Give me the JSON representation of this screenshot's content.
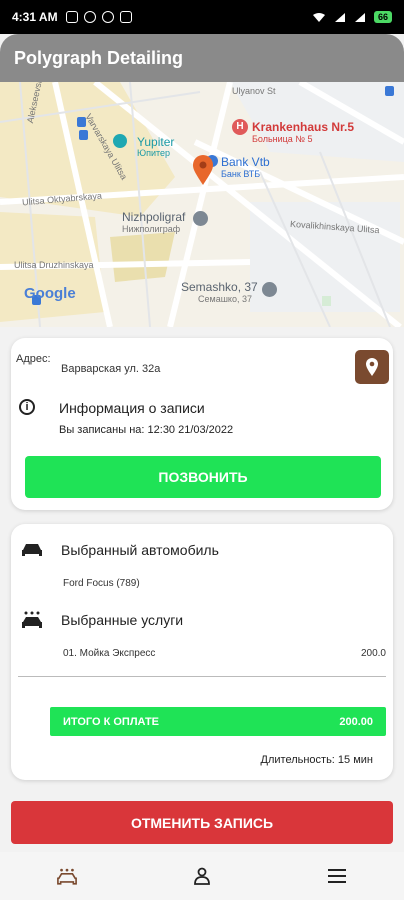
{
  "status_bar": {
    "time": "4:31 AM",
    "battery": "66"
  },
  "app": {
    "title": "Polygraph Detailing"
  },
  "map": {
    "labels": {
      "yupiter": "Yupiter",
      "yupiter_ru": "Юпитер",
      "krankenhaus": "Krankenhaus Nr.5",
      "krankenhaus_ru": "Больница № 5",
      "bank": "Bank Vtb",
      "bank_ru": "Банк ВТБ",
      "nizhpoligraf": "Nizhpoligraf",
      "nizhpoligraf_ru": "Нижполиграф",
      "semashko": "Semashko, 37",
      "semashko_ru": "Семашко, 37",
      "ulitsa_oktyabrskaya": "Ulitsa Oktyabrskaya",
      "ulitsa_druzhinskaya": "Ulitsa Druzhinskaya",
      "alekseevskaya": "Alekseevskaya Ulitsa",
      "varvarskaya": "Varvarskaya Ulitsa",
      "kovalikhinskaya": "Kovalikhinskaya Ulitsa",
      "ulyanov": "Ulyanov St",
      "google": "Google"
    }
  },
  "booking": {
    "address_label": "Адрес:",
    "address_value": "Варварская ул. 32а",
    "info_title": "Информация о записи",
    "info_sub": "Вы записаны на: 12:30 21/03/2022",
    "call_button": "ПОЗВОНИТЬ"
  },
  "details": {
    "car_title": "Выбранный автомобиль",
    "car_value": "Ford Focus (789)",
    "services_title": "Выбранные услуги",
    "services": [
      {
        "name": "01. Мойка Экспресс",
        "price": "200.0"
      }
    ],
    "total_label": "ИТОГО К ОПЛАТЕ",
    "total_value": "200.00",
    "duration": "Длительность: 15 мин"
  },
  "cancel_button": "ОТМЕНИТЬ ЗАПИСЬ",
  "colors": {
    "green": "#1fe356",
    "red": "#d9363a",
    "brown": "#7a4a2f",
    "pin": "#e8672b"
  }
}
